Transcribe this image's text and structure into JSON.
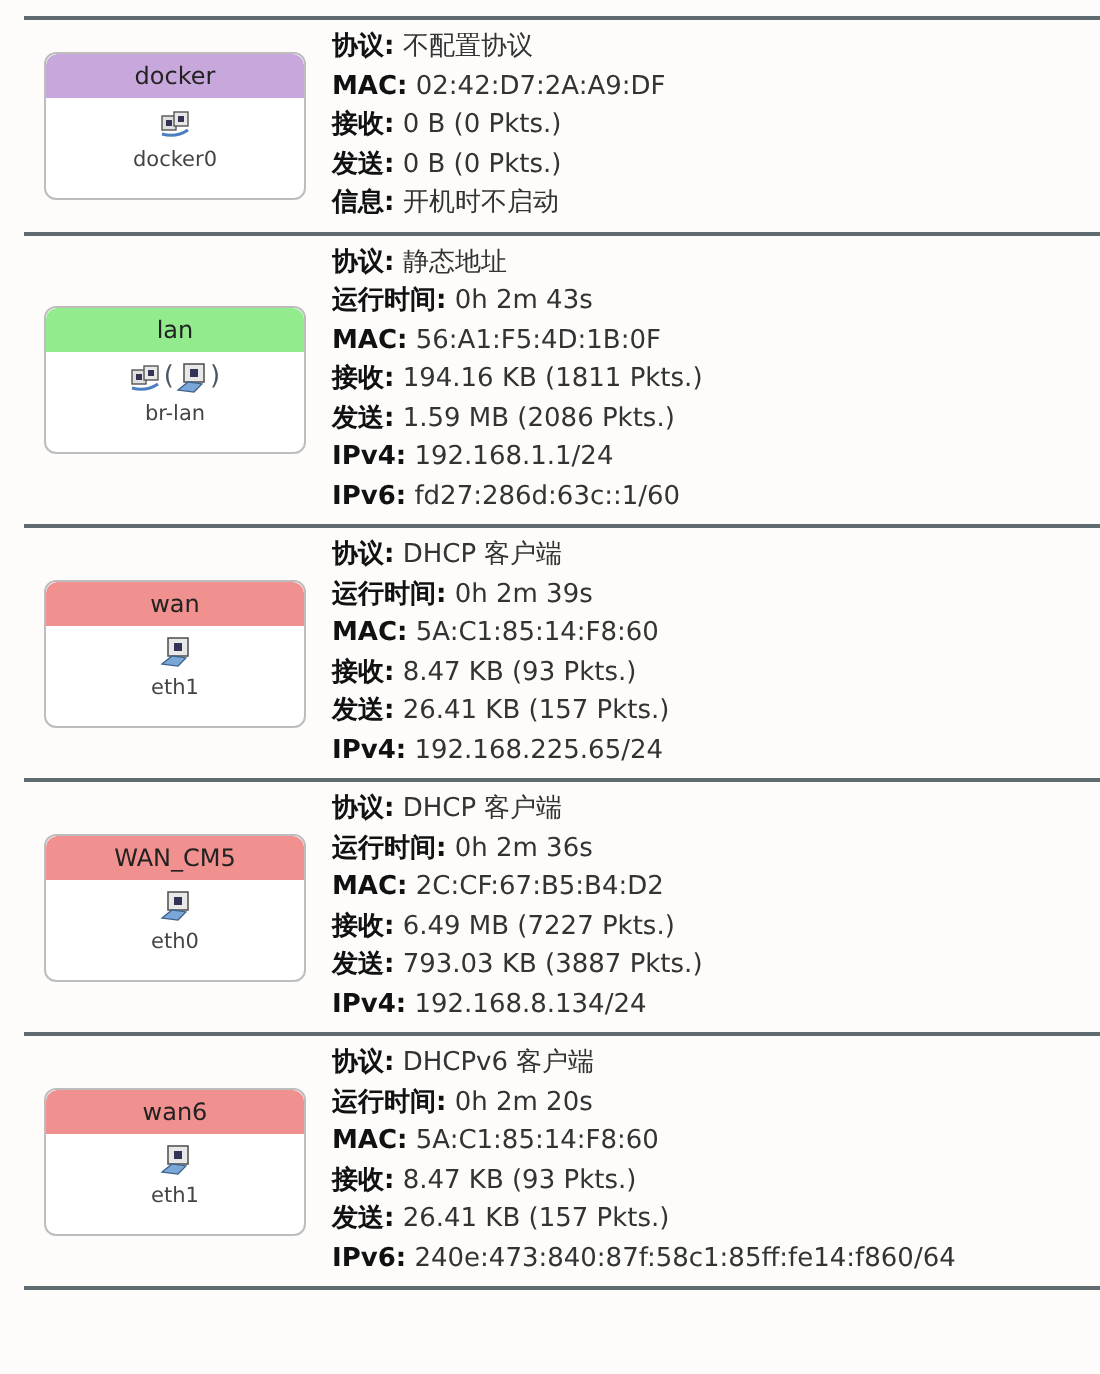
{
  "interfaces": [
    {
      "name": "docker",
      "color": "#c8a8dc",
      "device": "docker0",
      "icons": [
        {
          "kind": "switch"
        }
      ],
      "lines": [
        "**协议:** 不配置协议",
        "**MAC:** 02:42:D7:2A:A9:DF",
        "**接收:** 0 B (0 Pkts.)",
        "**发送:** 0 B (0 Pkts.)",
        "**信息:** 开机时不启动"
      ]
    },
    {
      "name": "lan",
      "color": "#92ec8e",
      "device": "br-lan",
      "icons": [
        {
          "kind": "switch"
        },
        {
          "kind": "text",
          "text": "("
        },
        {
          "kind": "port"
        },
        {
          "kind": "text",
          "text": ")"
        }
      ],
      "lines": [
        "**协议:** 静态地址",
        "**运行时间:** 0h 2m 43s",
        "**MAC:** 56:A1:F5:4D:1B:0F",
        "**接收:** 194.16 KB (1811 Pkts.)",
        "**发送:** 1.59 MB (2086 Pkts.)",
        "**IPv4:** 192.168.1.1/24",
        "**IPv6:** fd27:286d:63c::1/60"
      ]
    },
    {
      "name": "wan",
      "color": "#f0908f",
      "device": "eth1",
      "icons": [
        {
          "kind": "port"
        }
      ],
      "lines": [
        "**协议:** DHCP 客户端",
        "**运行时间:** 0h 2m 39s",
        "**MAC:** 5A:C1:85:14:F8:60",
        "**接收:** 8.47 KB (93 Pkts.)",
        "**发送:** 26.41 KB (157 Pkts.)",
        "**IPv4:** 192.168.225.65/24"
      ]
    },
    {
      "name": "WAN_CM5",
      "color": "#f0908f",
      "device": "eth0",
      "icons": [
        {
          "kind": "port"
        }
      ],
      "lines": [
        "**协议:** DHCP 客户端",
        "**运行时间:** 0h 2m 36s",
        "**MAC:** 2C:CF:67:B5:B4:D2",
        "**接收:** 6.49 MB (7227 Pkts.)",
        "**发送:** 793.03 KB (3887 Pkts.)",
        "**IPv4:** 192.168.8.134/24"
      ]
    },
    {
      "name": "wan6",
      "color": "#f0908f",
      "device": "eth1",
      "icons": [
        {
          "kind": "port"
        }
      ],
      "lines": [
        "**协议:** DHCPv6 客户端",
        "**运行时间:** 0h 2m 20s",
        "**MAC:** 5A:C1:85:14:F8:60",
        "**接收:** 8.47 KB (93 Pkts.)",
        "**发送:** 26.41 KB (157 Pkts.)",
        "**IPv6:** 240e:473:840:87f:58c1:85ff:fe14:f860/64"
      ]
    }
  ]
}
